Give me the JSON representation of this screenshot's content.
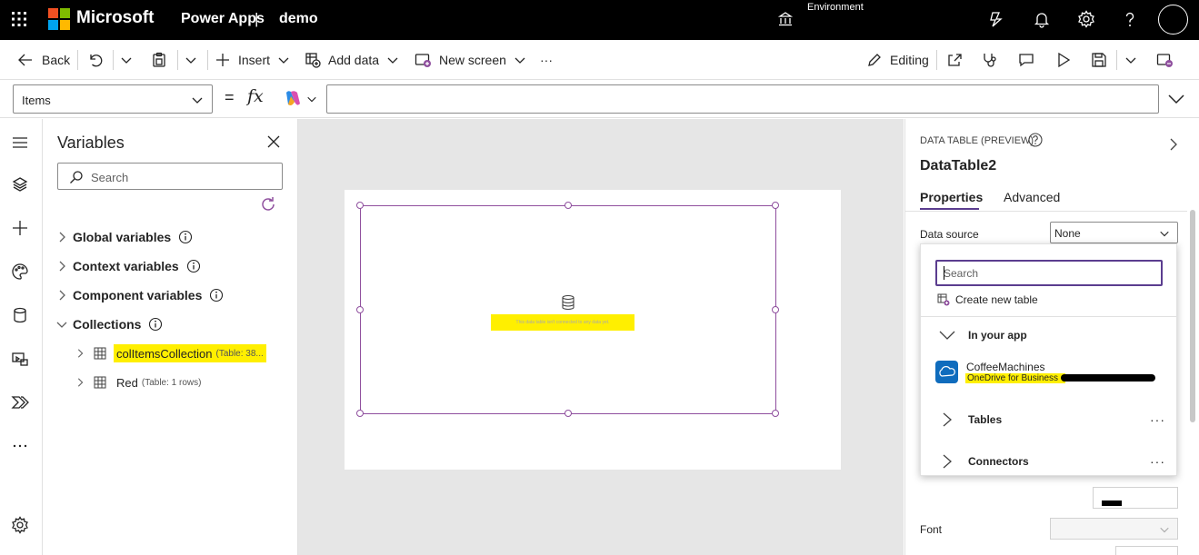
{
  "topbar": {
    "brand": "Microsoft",
    "product": "Power Apps",
    "separator": "|",
    "app_name": "demo",
    "environment_label": "Environment",
    "icons": [
      "waffle-icon",
      "environment-icon",
      "copilot-icon",
      "bell-icon",
      "gear-icon",
      "help-icon",
      "avatar"
    ]
  },
  "commandbar": {
    "back": "Back",
    "insert": "Insert",
    "add_data": "Add data",
    "new_screen": "New screen",
    "more": "···",
    "editing": "Editing"
  },
  "formulabar": {
    "property": "Items",
    "equals": "=",
    "fx": "fx",
    "formula": ""
  },
  "variables": {
    "title": "Variables",
    "search_placeholder": "Search",
    "groups": {
      "global": "Global variables",
      "context": "Context variables",
      "component": "Component variables",
      "collections": "Collections"
    },
    "collections": [
      {
        "name": "colItemsCollection",
        "meta": "(Table: 38..."
      },
      {
        "name": "Red",
        "meta": "(Table: 1 rows)"
      }
    ]
  },
  "canvas": {
    "empty_message": "This data table isn't connected to any data yet."
  },
  "properties": {
    "control_type": "DATA TABLE (PREVIEW)",
    "control_name": "DataTable2",
    "tabs": [
      "Properties",
      "Advanced"
    ],
    "data_source_label": "Data source",
    "data_source_value": "None",
    "font_label": "Font"
  },
  "datasource_dropdown": {
    "search_placeholder": "Search",
    "create_table": "Create new table",
    "in_your_app": "In your app",
    "source_name": "CoffeeMachines",
    "source_type": "OneDrive for Business -",
    "tables": "Tables",
    "connectors": "Connectors",
    "more": "···"
  },
  "colors": {
    "accent": "#5b3d8f",
    "selection": "#8f4f9e",
    "highlight": "#ffef00",
    "topbar": "#000000"
  }
}
